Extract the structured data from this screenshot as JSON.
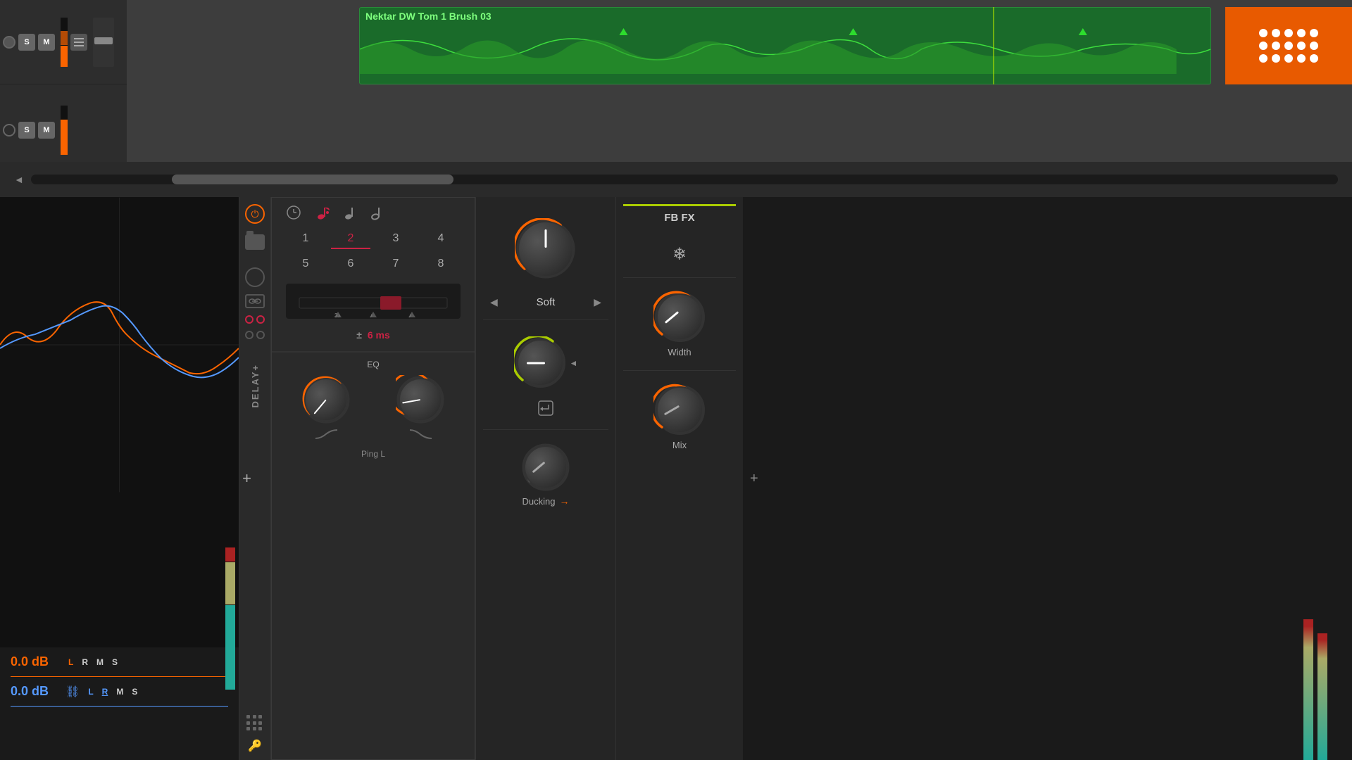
{
  "daw": {
    "track1": {
      "name": "Nektar DW Tom 1 Brush 03",
      "s_label": "S",
      "m_label": "M",
      "db": "0.0 dB"
    },
    "track2": {
      "s_label": "S",
      "m_label": "M"
    }
  },
  "meters": {
    "orange_db": "0.0 dB",
    "blue_db": "0.0 dB",
    "l_label": "L",
    "r_label": "R",
    "m_label": "M",
    "s_label": "S"
  },
  "delay_plugin": {
    "label": "DELAY+",
    "ping_label": "Ping L",
    "time_values": [
      "1",
      "2",
      "3",
      "4",
      "5",
      "6",
      "7",
      "8"
    ],
    "active_value": "2",
    "ms_value": "6 ms",
    "ms_prefix": "±",
    "eq_label": "EQ",
    "soft_label": "Soft",
    "ducking_label": "Ducking",
    "width_label": "Width",
    "mix_label": "Mix",
    "fb_fx_label": "FB FX"
  },
  "icons": {
    "power": "⏻",
    "snowflake": "❄",
    "link": "⛓",
    "arrow_left": "◀",
    "arrow_right": "▶",
    "arrow_left_small": "◄",
    "arrow_right_small": "►",
    "plus": "+",
    "return": "↵",
    "note_dotted": "♩",
    "note_eighth": "♪",
    "note_quarter": "♩",
    "note_half": "𝅗",
    "clock": "🕐"
  },
  "colors": {
    "orange": "#fa6400",
    "green_accent": "#aacc00",
    "red_accent": "#cc2244",
    "blue_accent": "#5599ff",
    "bg_dark": "#1a1a1a",
    "bg_medium": "#2a2a2a",
    "bg_light": "#3a3a3a",
    "track_green": "#1a7a2a",
    "orange_badge": "#e85a00"
  }
}
